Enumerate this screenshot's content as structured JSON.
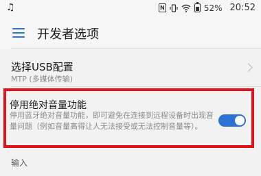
{
  "status_bar": {
    "music_icon": "music-note-icon",
    "icons": [
      "nfc-icon",
      "vibrate-icon",
      "wifi-icon",
      "battery-icon"
    ],
    "battery_percent": "52%",
    "time": "20:52"
  },
  "app_bar": {
    "menu_icon": "menu-icon",
    "title": "开发者选项"
  },
  "settings": {
    "usb_config": {
      "title": "选择USB配置",
      "value": "MTP (多媒体传输)"
    },
    "disable_absolute_volume": {
      "title": "停用绝对音量功能",
      "description": "停用蓝牙绝对音量功能，即可避免在连接到远程设备时出现音量问题（例如音量高得让人无法接受或无法控制音量等）。",
      "enabled": true
    },
    "section_input": "输入"
  },
  "colors": {
    "accent": "#2f72d6",
    "highlight_border": "#e0131c"
  }
}
